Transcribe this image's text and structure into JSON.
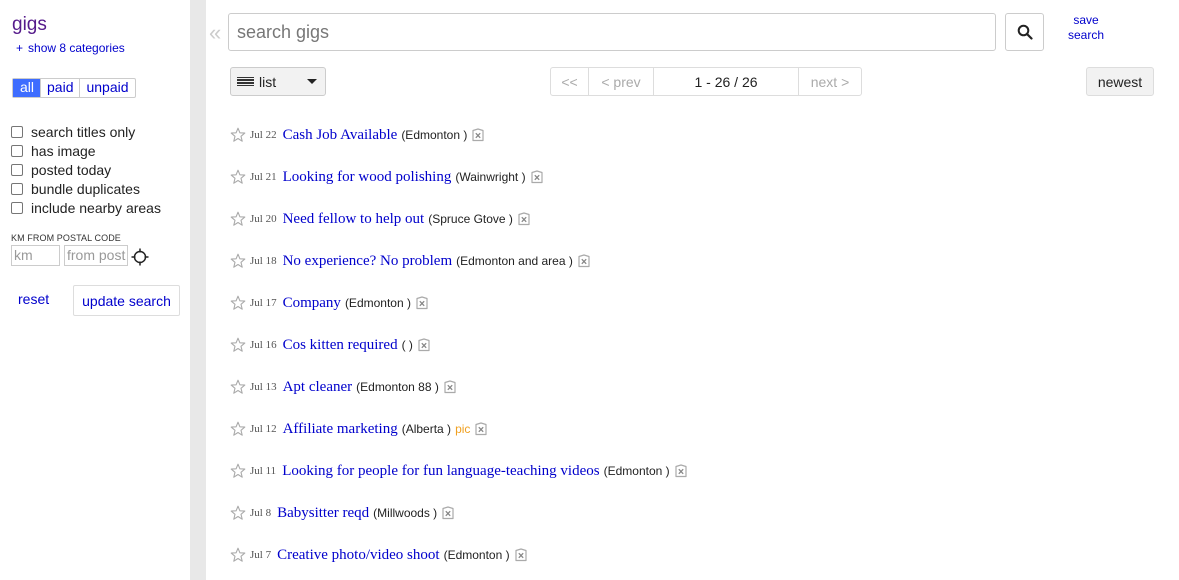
{
  "sidebar": {
    "title": "gigs",
    "categories_link": "show 8 categories",
    "plus": "+",
    "filter_tabs": [
      "all",
      "paid",
      "unpaid"
    ],
    "active_tab": "all",
    "options": [
      "search titles only",
      "has image",
      "posted today",
      "bundle duplicates",
      "include nearby areas"
    ],
    "km_label": "KM FROM POSTAL CODE",
    "km_placeholder": "km",
    "postal_placeholder": "from post",
    "reset_label": "reset",
    "update_label": "update search"
  },
  "header": {
    "collapse_glyph": "«",
    "search_placeholder": "search gigs",
    "save_search": [
      "save",
      "search"
    ]
  },
  "toolbar": {
    "view_label": "list",
    "pager": {
      "first": "<<",
      "prev": "< prev",
      "range": "1 - 26 / 26",
      "next": "next >"
    },
    "sort_label": "newest"
  },
  "listings": [
    {
      "date": "Jul 22",
      "title": "Cash Job Available",
      "location": "(Edmonton )",
      "pic": ""
    },
    {
      "date": "Jul 21",
      "title": "Looking for wood polishing",
      "location": "(Wainwright )",
      "pic": ""
    },
    {
      "date": "Jul 20",
      "title": "Need fellow to help out",
      "location": "(Spruce Gtove )",
      "pic": ""
    },
    {
      "date": "Jul 18",
      "title": "No experience? No problem",
      "location": "(Edmonton and area )",
      "pic": ""
    },
    {
      "date": "Jul 17",
      "title": "Company",
      "location": "(Edmonton )",
      "pic": ""
    },
    {
      "date": "Jul 16",
      "title": "Cos kitten required",
      "location": "( )",
      "pic": ""
    },
    {
      "date": "Jul 13",
      "title": "Apt cleaner",
      "location": "(Edmonton 88 )",
      "pic": ""
    },
    {
      "date": "Jul 12",
      "title": "Affiliate marketing",
      "location": "(Alberta )",
      "pic": "pic"
    },
    {
      "date": "Jul 11",
      "title": "Looking for people for fun language-teaching videos",
      "location": "(Edmonton )",
      "pic": ""
    },
    {
      "date": "Jul 8",
      "title": "Babysitter reqd",
      "location": "(Millwoods )",
      "pic": ""
    },
    {
      "date": "Jul 7",
      "title": "Creative photo/video shoot",
      "location": "(Edmonton )",
      "pic": ""
    }
  ],
  "colors": {
    "link": "#0000cc",
    "title_purple": "#551a8b",
    "active_tab": "#3e6dff",
    "pic_tag": "#f0a020"
  }
}
